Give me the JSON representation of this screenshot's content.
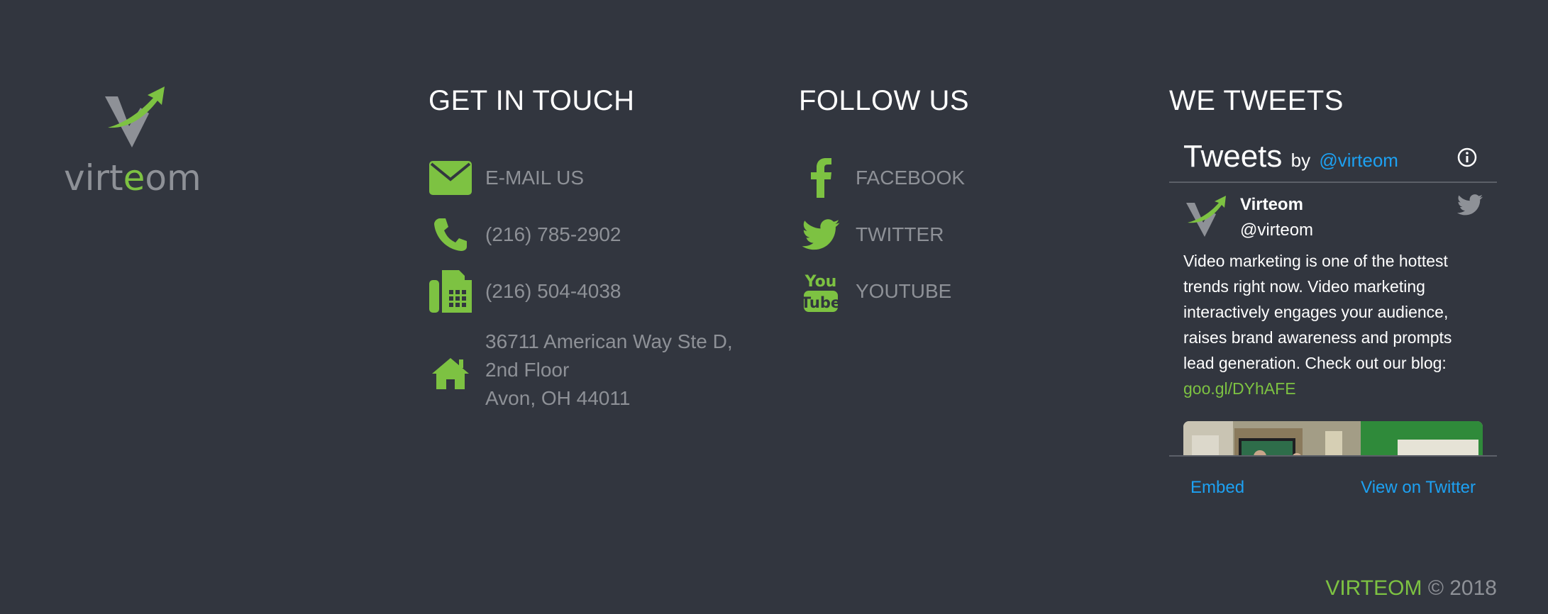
{
  "logo": {
    "text_pre": "virt",
    "text_accent": "e",
    "text_post": "om",
    "icon": "virteom-v-arrow-logo"
  },
  "contact": {
    "title": "GET IN TOUCH",
    "items": [
      {
        "icon": "envelope-icon",
        "label": "E-MAIL US"
      },
      {
        "icon": "phone-icon",
        "label": "(216) 785-2902"
      },
      {
        "icon": "fax-icon",
        "label": "(216) 504-4038"
      },
      {
        "icon": "home-icon",
        "line1": "36711 American Way Ste D,",
        "line2": "2nd Floor",
        "line3": "Avon, OH 44011"
      }
    ]
  },
  "social": {
    "title": "FOLLOW US",
    "items": [
      {
        "icon": "facebook-icon",
        "label": "FACEBOOK"
      },
      {
        "icon": "twitter-icon",
        "label": "TWITTER"
      },
      {
        "icon": "youtube-icon",
        "label": "YOUTUBE"
      }
    ]
  },
  "tweets": {
    "title": "WE TWEETS",
    "widget": {
      "header_title": "Tweets",
      "header_by": "by",
      "header_handle": "@virteom",
      "tweet": {
        "name": "Virteom",
        "handle": "@virteom",
        "text": "Video marketing is one of the hottest trends right now. Video marketing interactively engages your audience, raises brand awareness and prompts lead generation. Check out our blog:",
        "link": "goo.gl/DYhAFE"
      },
      "footer_embed": "Embed",
      "footer_view": "View on Twitter"
    }
  },
  "copyright": {
    "brand": "VIRTEOM",
    "rest": "© 2018"
  },
  "colors": {
    "background": "#32363f",
    "accent_green": "#7dc242",
    "muted_text": "#8e9197",
    "twitter_blue": "#1da1f2"
  }
}
